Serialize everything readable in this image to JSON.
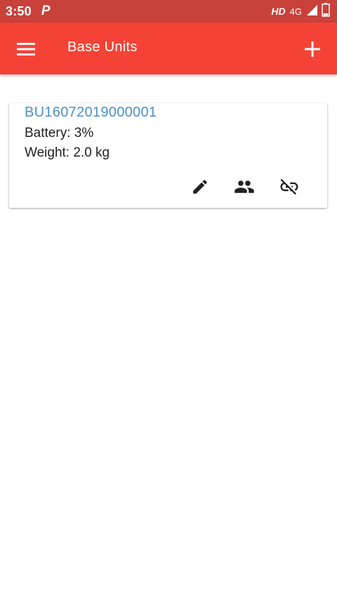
{
  "status_bar": {
    "time": "3:50",
    "app_indicator": "P",
    "hd": "HD",
    "network": "4G"
  },
  "app_bar": {
    "title": "Base Units",
    "menu_icon": "hamburger-menu-icon",
    "add_icon": "plus-icon"
  },
  "base_units": [
    {
      "id": "BU16072019000001",
      "battery": "Battery: 3%",
      "weight": "Weight: 2.0 kg",
      "actions": [
        "pencil-icon",
        "people-icon",
        "link-off-icon"
      ]
    }
  ],
  "colors": {
    "status_bar": "#c8413a",
    "app_bar": "#f44336",
    "link_text": "#4a90c8",
    "body_text": "#212121"
  }
}
